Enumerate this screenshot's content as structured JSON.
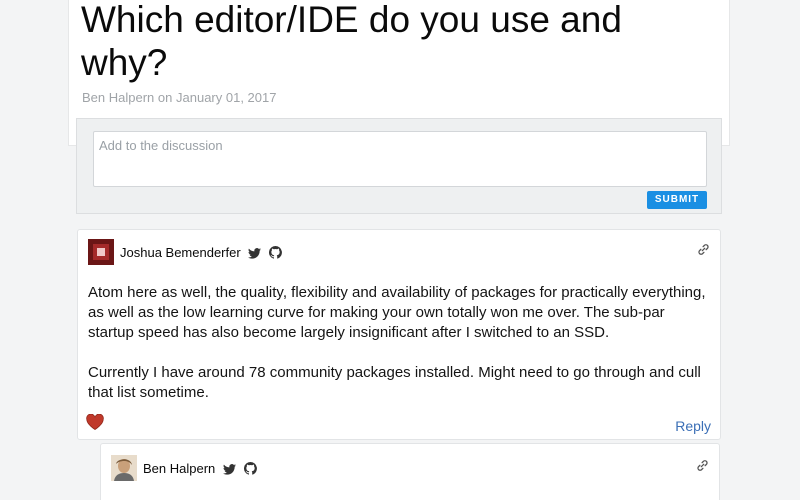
{
  "article": {
    "title": "Which editor/IDE do you use and why?",
    "author": "Ben Halpern",
    "date_prefix": "on",
    "date": "January 01, 2017"
  },
  "discussion": {
    "placeholder": "Add to the discussion",
    "submit_label": "SUBMIT"
  },
  "comments": [
    {
      "author": "Joshua Bemenderfer",
      "social_icons": [
        "twitter-icon",
        "github-icon"
      ],
      "paragraphs": [
        "Atom here as well, the quality, flexibility and availability of packages for practically everything, as well as the low learning curve for making your own totally won me over. The sub-par startup speed has also become largely insignificant after I switched to an SSD.",
        "Currently I have around 78 community packages installed. Might need to go through and cull that list sometime."
      ],
      "reaction_icon": "heart-icon",
      "reply_label": "Reply"
    },
    {
      "author": "Ben Halpern",
      "social_icons": [
        "twitter-icon",
        "github-icon"
      ]
    }
  ],
  "colors": {
    "background": "#f3f4f5",
    "submit": "#1a8fe3",
    "reply_link": "#3b6fb6",
    "heart": "#c0392b"
  }
}
